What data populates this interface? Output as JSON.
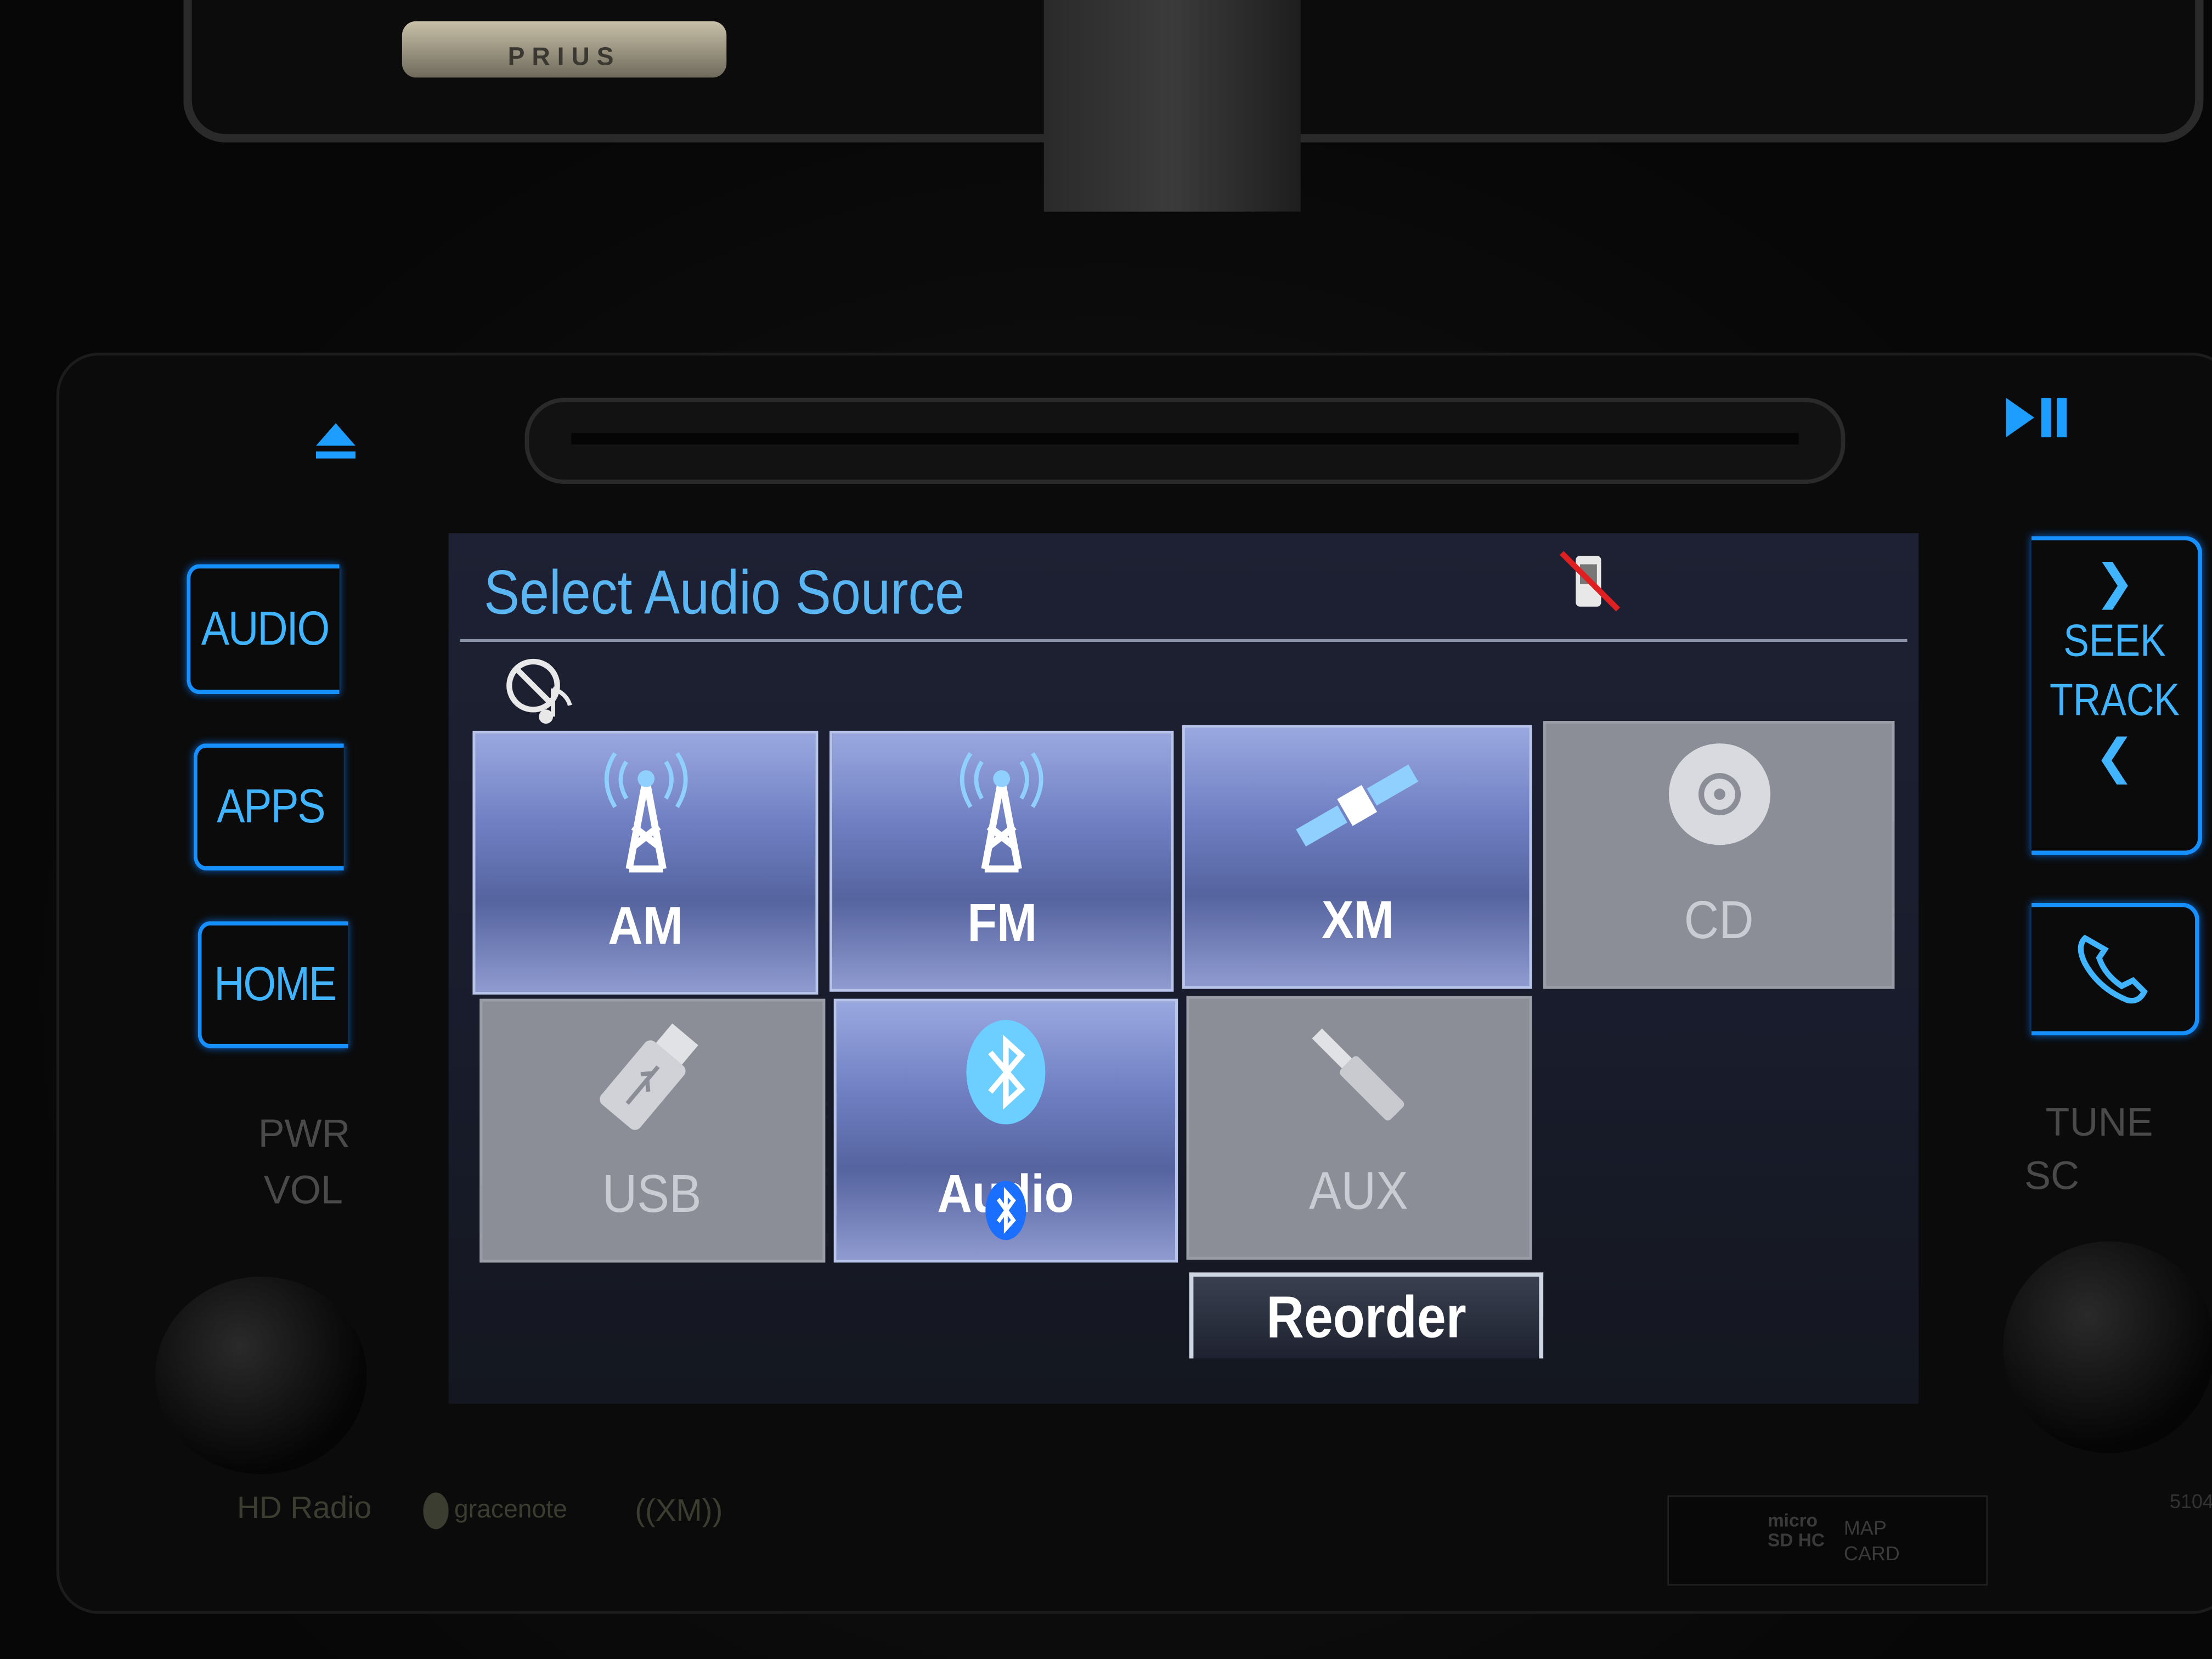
{
  "hardware": {
    "car_badge": "PRIUS",
    "left_buttons": [
      {
        "label": "AUDIO"
      },
      {
        "label": "APPS"
      },
      {
        "label": "HOME"
      }
    ],
    "pwr_label": "PWR",
    "vol_label": "VOL",
    "seek_label": "SEEK",
    "track_label": "TRACK",
    "tune_label": "TUNE",
    "scroll_label": "SC",
    "logos": {
      "hd_radio": "HD Radio",
      "gracenote": "gracenote",
      "xm": "((XM))"
    },
    "sd_slot": {
      "logo": "micro SD HC",
      "label_line1": "MAP",
      "label_line2": "CARD"
    },
    "serial": "5104",
    "accent_color": "#1d9eff"
  },
  "screen": {
    "title": "Select Audio Source",
    "status_icons": [
      "phone-disconnected-icon",
      "music-off-icon"
    ],
    "sources": [
      {
        "label": "AM",
        "icon": "radio-tower-icon",
        "enabled": true
      },
      {
        "label": "FM",
        "icon": "radio-tower-icon",
        "enabled": true
      },
      {
        "label": "XM",
        "icon": "satellite-icon",
        "enabled": true
      },
      {
        "label": "CD",
        "icon": "disc-icon",
        "enabled": false
      },
      {
        "label": "USB",
        "icon": "usb-icon",
        "enabled": false
      },
      {
        "label": "Audio",
        "icon": "bluetooth-icon",
        "enabled": true
      },
      {
        "label": "AUX",
        "icon": "aux-jack-icon",
        "enabled": false
      }
    ],
    "reorder_label": "Reorder",
    "title_color": "#5ab6f2"
  }
}
